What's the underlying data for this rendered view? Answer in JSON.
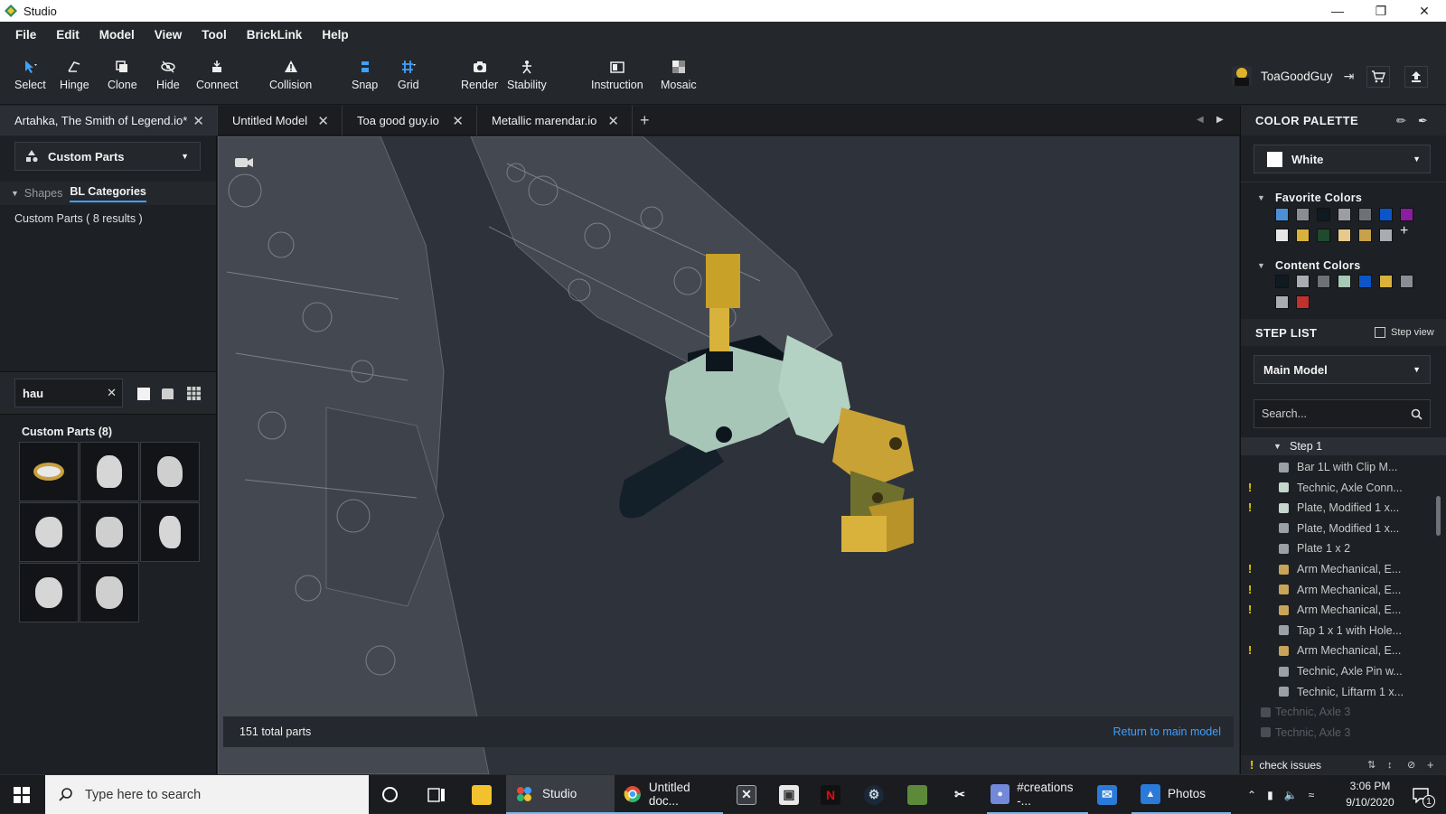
{
  "window": {
    "title": "Studio"
  },
  "menu": [
    "File",
    "Edit",
    "Model",
    "View",
    "Tool",
    "BrickLink",
    "Help"
  ],
  "toolbar": {
    "tools": [
      "Select",
      "Hinge",
      "Clone",
      "Hide",
      "Connect",
      "Collision",
      "Snap",
      "Grid",
      "Render",
      "Stability",
      "Instruction",
      "Mosaic"
    ],
    "user_name": "ToaGoodGuy"
  },
  "tabs": [
    "Artahka, The Smith of Legend.io*",
    "Untitled Model",
    "Toa good guy.io",
    "Metallic marendar.io"
  ],
  "left_panel": {
    "category_dropdown": "Custom Parts",
    "nav_shapes": "Shapes",
    "nav_bl_categories": "BL Categories",
    "results_text": "Custom Parts ( 8 results )",
    "search_value": "hau",
    "grid_title": "Custom Parts (8)"
  },
  "viewport": {
    "total_parts": "151 total parts",
    "return_link": "Return to main model"
  },
  "color_palette": {
    "header": "COLOR PALETTE",
    "selected_color": "White",
    "favorite_header": "Favorite Colors",
    "favorite_colors": [
      "#4d8fd6",
      "#8a8e94",
      "#0f1a22",
      "#9b9ea3",
      "#6e7276",
      "#0b55c9",
      "#8a1da0",
      "#e6e6e6",
      "#d8b23a",
      "#1f4a2e",
      "#e8c98c",
      "#c9a14a",
      "#a9adb2"
    ],
    "content_header": "Content Colors",
    "content_colors": [
      "#0f1a22",
      "#a9adb2",
      "#6e7276",
      "#a8c8b8",
      "#0b55c9",
      "#d8b23a",
      "#8a8e94",
      "#a9adb2",
      "#c0302c"
    ]
  },
  "step_list": {
    "header": "STEP LIST",
    "step_view_label": "Step view",
    "model_dropdown": "Main Model",
    "search_placeholder": "Search...",
    "step_label": "Step 1",
    "items": [
      {
        "label": "Bar   1L with Clip M...",
        "warn": false,
        "color": "#9aa0a6"
      },
      {
        "label": "Technic, Axle Conn...",
        "warn": true,
        "color": "#c5d6cc"
      },
      {
        "label": "Plate, Modified 1 x...",
        "warn": true,
        "color": "#c5d6cc"
      },
      {
        "label": "Plate, Modified 1 x...",
        "warn": false,
        "color": "#9aa0a6"
      },
      {
        "label": "Plate 1 x 2",
        "warn": false,
        "color": "#9aa0a6"
      },
      {
        "label": "Arm Mechanical, E...",
        "warn": true,
        "color": "#c8a35a"
      },
      {
        "label": "Arm Mechanical, E...",
        "warn": true,
        "color": "#c8a35a"
      },
      {
        "label": "Arm Mechanical, E...",
        "warn": true,
        "color": "#c8a35a"
      },
      {
        "label": "Tap 1 x 1 with Hole...",
        "warn": false,
        "color": "#9aa0a6"
      },
      {
        "label": "Arm Mechanical, E...",
        "warn": true,
        "color": "#c8a35a"
      },
      {
        "label": "Technic, Axle Pin w...",
        "warn": false,
        "color": "#9aa0a6"
      },
      {
        "label": "Technic, Liftarm 1 x...",
        "warn": false,
        "color": "#9aa0a6"
      }
    ],
    "dim_items": [
      "Technic, Axle 3",
      "Technic, Axle 3"
    ],
    "footer_label": "check issues"
  },
  "taskbar": {
    "search_placeholder": "Type here to search",
    "apps": [
      "Studio",
      "Untitled doc...",
      "#creations -...",
      "Photos"
    ],
    "time": "3:06 PM",
    "date": "9/10/2020",
    "notif_count": "1"
  }
}
